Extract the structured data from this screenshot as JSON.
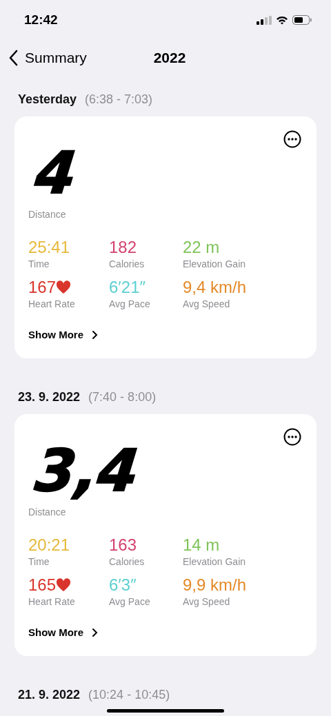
{
  "status_bar": {
    "time": "12:42"
  },
  "nav": {
    "back_label": "Summary",
    "title": "2022"
  },
  "workouts": [
    {
      "date": "Yesterday",
      "time_range": "(6:38 - 7:03)",
      "distance": "4",
      "distance_label": "Distance",
      "stats": [
        {
          "value": "25:41",
          "label": "Time",
          "color": "#e6b93a",
          "heart": false
        },
        {
          "value": "182",
          "label": "Calories",
          "color": "#d4416f",
          "heart": false
        },
        {
          "value": "22 m",
          "label": "Elevation Gain",
          "color": "#7fc35a",
          "heart": false
        },
        {
          "value": "167",
          "label": "Heart Rate",
          "color": "#d9352c",
          "heart": true
        },
        {
          "value": "6′21″",
          "label": "Avg Pace",
          "color": "#5ccfd0",
          "heart": false
        },
        {
          "value": "9,4 km/h",
          "label": "Avg Speed",
          "color": "#e48a2a",
          "heart": false
        }
      ],
      "more": "Show More"
    },
    {
      "date": "23. 9. 2022",
      "time_range": "(7:40 - 8:00)",
      "distance": "3,4",
      "distance_label": "Distance",
      "stats": [
        {
          "value": "20:21",
          "label": "Time",
          "color": "#e6b93a",
          "heart": false
        },
        {
          "value": "163",
          "label": "Calories",
          "color": "#d4416f",
          "heart": false
        },
        {
          "value": "14 m",
          "label": "Elevation Gain",
          "color": "#7fc35a",
          "heart": false
        },
        {
          "value": "165",
          "label": "Heart Rate",
          "color": "#d9352c",
          "heart": true
        },
        {
          "value": "6′3″",
          "label": "Avg Pace",
          "color": "#5ccfd0",
          "heart": false
        },
        {
          "value": "9,9 km/h",
          "label": "Avg Speed",
          "color": "#e48a2a",
          "heart": false
        }
      ],
      "more": "Show More"
    },
    {
      "date": "21. 9. 2022",
      "time_range": "(10:24 - 10:45)"
    }
  ]
}
